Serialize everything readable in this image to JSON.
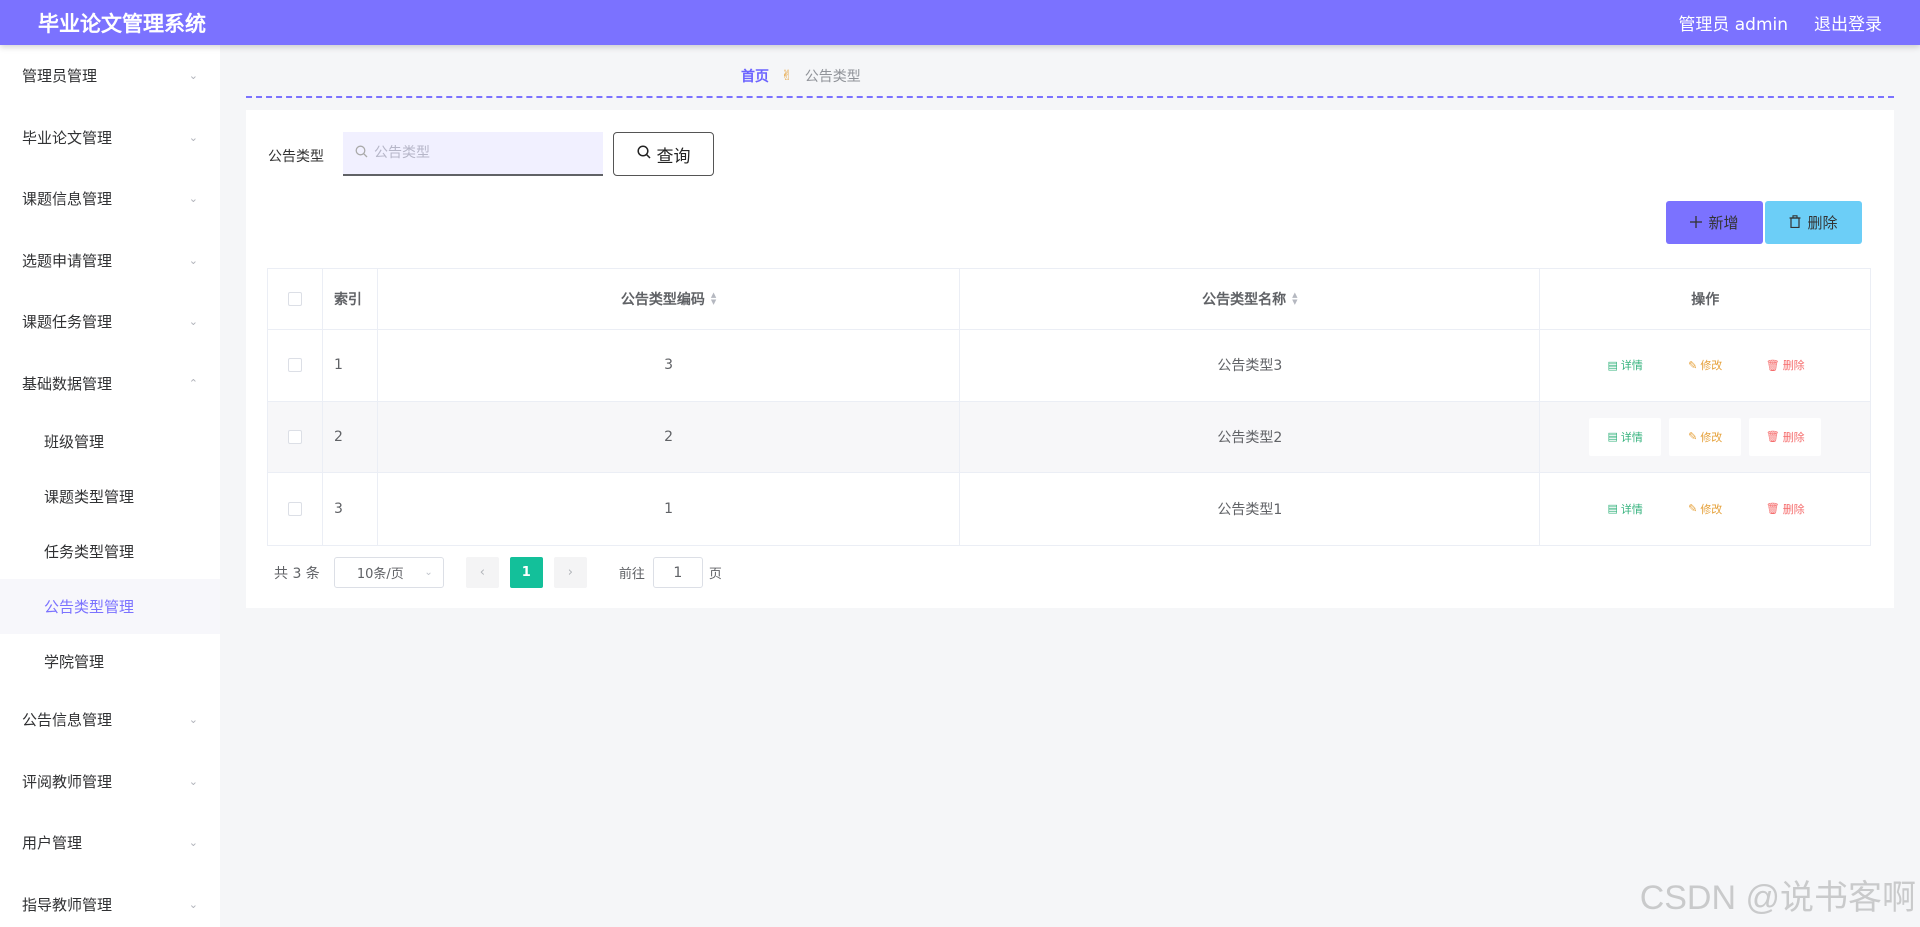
{
  "header": {
    "title": "毕业论文管理系统",
    "user_label": "管理员 admin",
    "logout_label": "退出登录",
    "bg_color": "#7b72ff"
  },
  "sidebar": {
    "items_top": [
      {
        "label": "管理员管理",
        "chevron": "⌄"
      },
      {
        "label": "毕业论文管理",
        "chevron": "⌄"
      },
      {
        "label": "课题信息管理",
        "chevron": "⌄"
      },
      {
        "label": "选题申请管理",
        "chevron": "⌄"
      },
      {
        "label": "课题任务管理",
        "chevron": "⌄"
      },
      {
        "label": "基础数据管理",
        "chevron": "⌃"
      }
    ],
    "submenu": [
      {
        "label": "班级管理"
      },
      {
        "label": "课题类型管理"
      },
      {
        "label": "任务类型管理"
      },
      {
        "label": "公告类型管理"
      },
      {
        "label": "学院管理"
      }
    ],
    "active_submenu": "公告类型管理",
    "items_bottom": [
      {
        "label": "公告信息管理",
        "chevron": "⌄"
      },
      {
        "label": "评阅教师管理",
        "chevron": "⌄"
      },
      {
        "label": "用户管理",
        "chevron": "⌄"
      },
      {
        "label": "指导教师管理",
        "chevron": "⌄"
      }
    ]
  },
  "breadcrumb": {
    "home": "首页",
    "separator": "✌",
    "current": "公告类型"
  },
  "search": {
    "label": "公告类型",
    "placeholder": "公告类型",
    "icon": "search-icon",
    "query_label": "查询"
  },
  "actions": {
    "add_label": "新增",
    "delete_label": "删除",
    "add_color": "#7b72ff",
    "delete_color": "#6ccef7"
  },
  "table": {
    "headers": {
      "index": "索引",
      "code": "公告类型编码",
      "name": "公告类型名称",
      "ops": "操作"
    },
    "rows": [
      {
        "index": "1",
        "code": "3",
        "name": "公告类型3"
      },
      {
        "index": "2",
        "code": "2",
        "name": "公告类型2"
      },
      {
        "index": "3",
        "code": "1",
        "name": "公告类型1"
      }
    ],
    "op_labels": {
      "detail": "详情",
      "edit": "修改",
      "delete": "删除"
    }
  },
  "pagination": {
    "total_text": "共 3 条",
    "page_size": "10条/页",
    "current_page": "1",
    "goto_label": "前往",
    "goto_value": "1",
    "page_unit": "页",
    "active_color": "#13c09a"
  },
  "watermark": "CSDN @说书客啊"
}
